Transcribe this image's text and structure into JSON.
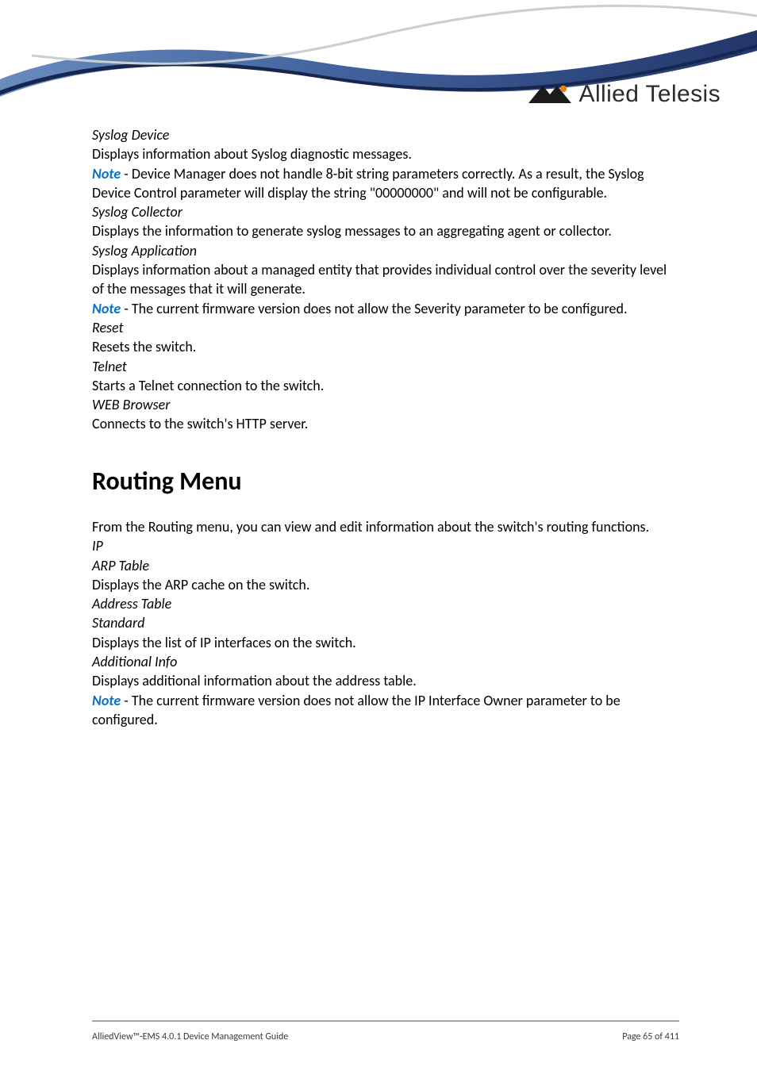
{
  "logo": {
    "text": "Allied Telesis"
  },
  "sections": {
    "syslog_device": {
      "heading": "Syslog Device",
      "body": "Displays information about Syslog diagnostic messages.",
      "note_prefix": "Note",
      "note_body": " - Device Manager does not handle 8-bit string parameters correctly. As a result, the Syslog Device Control parameter will display the string \"00000000\" and will not be configurable."
    },
    "syslog_collector": {
      "heading": "Syslog Collector",
      "body": "Displays the information to generate syslog messages to an aggregating agent or collector."
    },
    "syslog_application": {
      "heading": "Syslog Application",
      "body": "Displays information about a managed entity that provides individual control over the severity level of the messages that it will generate.",
      "note_prefix": "Note",
      "note_body": " - The current firmware version does not allow the Severity parameter to be configured."
    },
    "reset": {
      "heading": "Reset",
      "body": "Resets the switch."
    },
    "telnet": {
      "heading": "Telnet",
      "body": "Starts a Telnet connection to the switch."
    },
    "web_browser": {
      "heading": "WEB Browser",
      "body": "Connects to the switch's HTTP server."
    }
  },
  "routing": {
    "title": "Routing Menu",
    "intro": "From the Routing menu, you can view and edit information about the switch's routing functions.",
    "ip_heading": "IP",
    "arp_table": {
      "heading": "ARP Table",
      "body": "Displays the ARP cache on the switch."
    },
    "address_table": {
      "heading": "Address Table",
      "standard": {
        "heading": "Standard",
        "body": "Displays the list of IP interfaces on the switch."
      },
      "additional": {
        "heading": "Additional Info",
        "body": "Displays additional information about the address table."
      },
      "note_prefix": "Note",
      "note_body": " - The current firmware version does not allow the IP Interface Owner parameter to be configured."
    }
  },
  "footer": {
    "left": "AlliedView™-EMS 4.0.1 Device Management Guide",
    "right": "Page 65 of 411"
  }
}
